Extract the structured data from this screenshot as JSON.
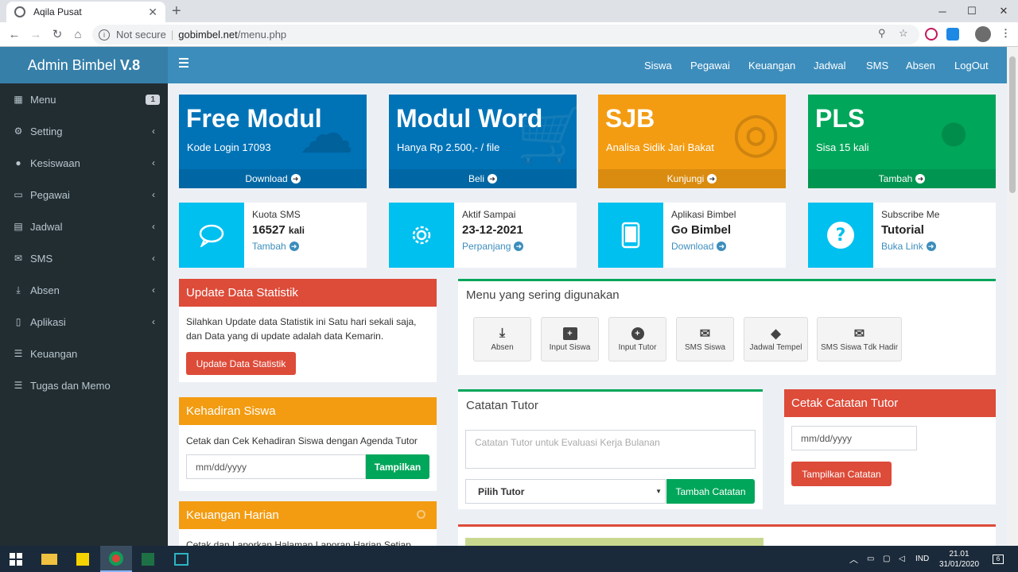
{
  "browser": {
    "tab_title": "Aqila Pusat",
    "security": "Not secure",
    "url_host": "gobimbel.net",
    "url_path": "/menu.php"
  },
  "app": {
    "logo_text": "Admin Bimbel",
    "logo_version": "V.8"
  },
  "sidebar": {
    "items": [
      {
        "label": "Menu",
        "badge": "1"
      },
      {
        "label": "Setting"
      },
      {
        "label": "Kesiswaan"
      },
      {
        "label": "Pegawai"
      },
      {
        "label": "Jadwal"
      },
      {
        "label": "SMS"
      },
      {
        "label": "Absen"
      },
      {
        "label": "Aplikasi"
      },
      {
        "label": "Keuangan"
      },
      {
        "label": "Tugas dan Memo"
      }
    ]
  },
  "topnav": {
    "items": [
      "Siswa",
      "Pegawai",
      "Keuangan",
      "Jadwal",
      "SMS",
      "Absen",
      "LogOut"
    ]
  },
  "small_boxes": [
    {
      "title": "Free Modul",
      "text": "Kode Login 17093",
      "footer": "Download",
      "color": "#0073b7"
    },
    {
      "title": "Modul Word",
      "text": "Hanya Rp 2.500,- / file",
      "footer": "Beli",
      "color": "#0073b7"
    },
    {
      "title": "SJB",
      "text": "Analisa Sidik Jari Bakat",
      "footer": "Kunjungi",
      "color": "#f39c12"
    },
    {
      "title": "PLS",
      "text": "Sisa 15 kali",
      "footer": "Tambah",
      "color": "#00a65a"
    }
  ],
  "info_boxes": [
    {
      "label": "Kuota SMS",
      "value": "16527",
      "unit": "kali",
      "link": "Tambah"
    },
    {
      "label": "Aktif Sampai",
      "value": "23-12-2021",
      "link": "Perpanjang"
    },
    {
      "label": "Aplikasi Bimbel",
      "value": "Go Bimbel",
      "link": "Download"
    },
    {
      "label": "Subscribe Me",
      "value": "Tutorial",
      "link": "Buka Link"
    }
  ],
  "update_stat": {
    "title": "Update Data Statistik",
    "text1": "Silahkan Update data Statistik ini Satu hari sekali saja,",
    "text2": "dan Data yang di update adalah data Kemarin.",
    "button": "Update Data Statistik"
  },
  "kehadiran": {
    "title": "Kehadiran Siswa",
    "text": "Cetak dan Cek Kehadiran Siswa dengan Agenda Tutor",
    "date_placeholder": "mm/dd/yyyy",
    "button": "Tampilkan"
  },
  "keuangan": {
    "title": "Keuangan Harian",
    "text": "Cetak dan Laporkan Halaman Laporan Harian Setiap"
  },
  "menu_sering": {
    "title": "Menu yang sering digunakan",
    "buttons": [
      "Absen",
      "Input Siswa",
      "Input Tutor",
      "SMS Siswa",
      "Jadwal Tempel",
      "SMS Siswa Tdk Hadir"
    ]
  },
  "catatan": {
    "title": "Catatan Tutor",
    "placeholder": "Catatan Tutor untuk Evaluasi Kerja Bulanan",
    "select": "Pilih Tutor",
    "button": "Tambah Catatan"
  },
  "cetak_catatan": {
    "title": "Cetak Catatan Tutor",
    "date_placeholder": "mm/dd/yyyy",
    "button": "Tampilkan Catatan"
  },
  "taskbar": {
    "lang": "IND",
    "time": "21.01",
    "date": "31/01/2020",
    "notif": "6"
  }
}
